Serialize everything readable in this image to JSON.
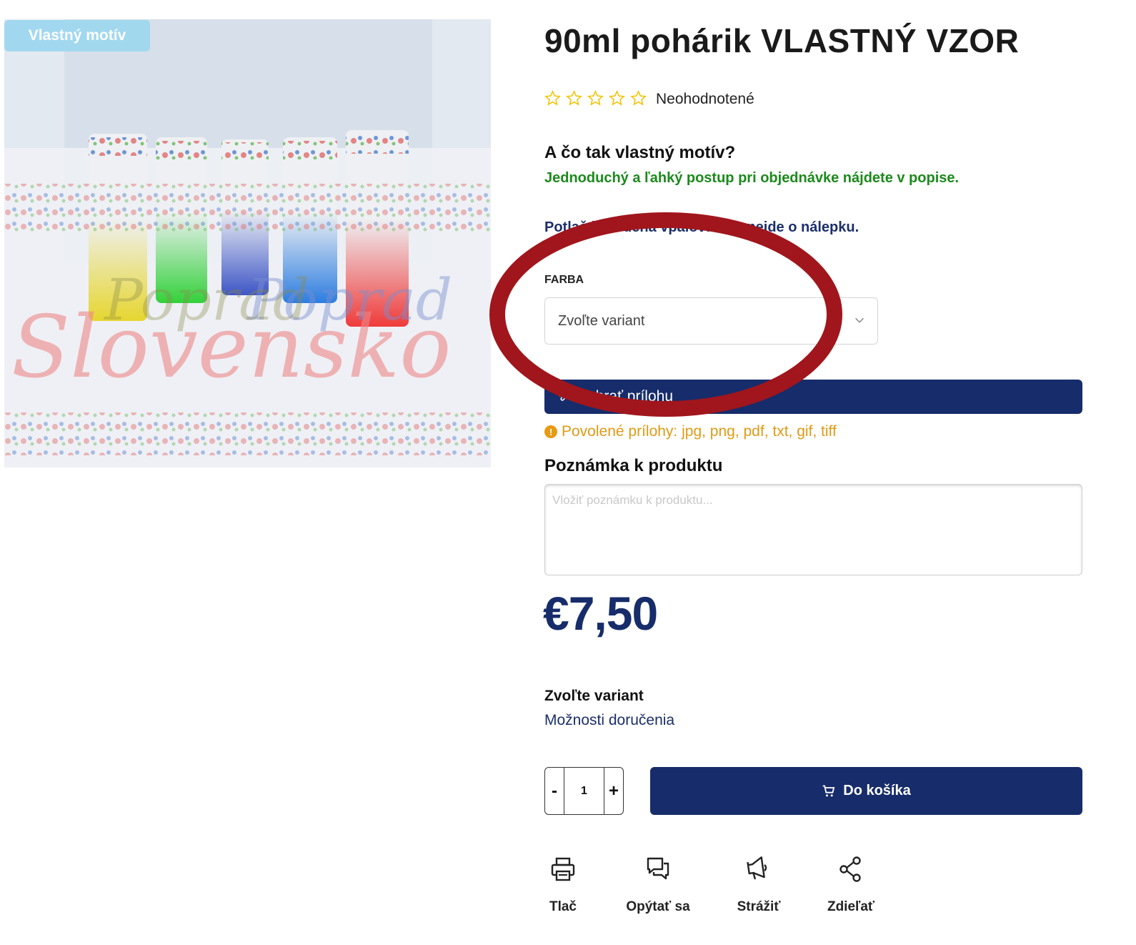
{
  "product": {
    "badge": "Vlastný motív",
    "title": "90ml pohárik VLASTNÝ VZOR",
    "rating_label": "Neohodnotené",
    "stars_total": 5,
    "stars_filled": 0,
    "motif_heading": "A čo tak vlastný motív?",
    "motif_sub": "Jednoduchý a ľahký postup pri objednávke nájdete v popise.",
    "print_note": "Potlač je vedená vpalovaním, nejde o nálepku.",
    "image_texts": {
      "brand": "Slovensko",
      "city": "Poprad"
    }
  },
  "options": {
    "farba_label": "FARBA",
    "select_value": "Zvoľte variant"
  },
  "attachment": {
    "button_label": "Vybrať prílohu",
    "allowed_text": "Povolené prílohy: jpg, png, pdf, txt, gif, tiff",
    "warn_glyph": "!"
  },
  "note": {
    "heading": "Poznámka k produktu",
    "placeholder": "Vložiť poznámku k produktu..."
  },
  "price": "€7,50",
  "variant_label": "Zvoľte variant",
  "delivery_link": "Možnosti doručenia",
  "cart": {
    "minus": "-",
    "quantity": "1",
    "plus": "+",
    "add_label": "Do košíka"
  },
  "actions": [
    {
      "label": "Tlač",
      "icon": "printer-icon"
    },
    {
      "label": "Opýtať sa",
      "icon": "chat-icon"
    },
    {
      "label": "Strážiť",
      "icon": "megaphone-icon"
    },
    {
      "label": "Zdieľať",
      "icon": "share-icon"
    }
  ],
  "colors": {
    "primary": "#172c6a",
    "green": "#1c8a1c",
    "warning": "#e09a14",
    "star": "#f2c200",
    "annotation": "#a0161c"
  }
}
